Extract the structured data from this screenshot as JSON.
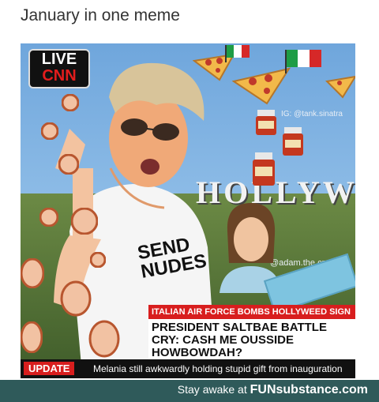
{
  "post": {
    "title": "January in one meme"
  },
  "meme": {
    "badge": {
      "live": "LIVE",
      "network": "CNN"
    },
    "watermarks": {
      "top": "IG: @tank.sinatra",
      "middle": "@adam.the.creator"
    },
    "sign": "HOLLYWEED",
    "shirt": {
      "line1": "SEND",
      "line2": "NUDES"
    },
    "headline_red": "ITALIAN AIR FORCE BOMBS HOLLYWEED SIGN",
    "headline_main": "PRESIDENT SALTBAE BATTLE CRY: CASH ME OUSSIDE HOWBOWDAH?",
    "ticker": {
      "label": "UPDATE",
      "text": "Melania still awkwardly holding stupid gift from inauguration"
    },
    "icons": [
      "pizza-icon",
      "italian-flag-icon",
      "sauce-jar-icon",
      "face-sticker-icon"
    ]
  },
  "footer": {
    "prefix": "Stay awake at",
    "brand": "FUNsubstance.com"
  },
  "colors": {
    "cnn_red": "#e31d1d",
    "footer_bg": "#2f5a5a",
    "ticker_bg": "#111111"
  }
}
